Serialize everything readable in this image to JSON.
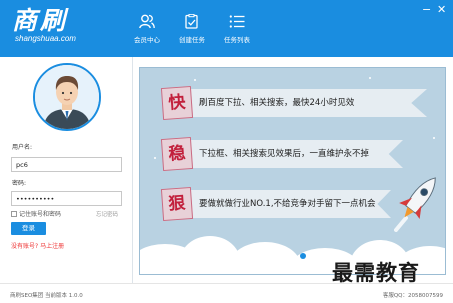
{
  "app": {
    "logo_text": "商刷",
    "logo_sub": "shangshuaa.com"
  },
  "nav": [
    {
      "label": "会员中心",
      "icon": "member-icon"
    },
    {
      "label": "创建任务",
      "icon": "create-task-icon"
    },
    {
      "label": "任务列表",
      "icon": "task-list-icon"
    }
  ],
  "window": {
    "minimize": "−",
    "close": "✕"
  },
  "login": {
    "username_label": "用户名:",
    "username_value": "pc6",
    "password_label": "密码:",
    "password_value": "••••••••••",
    "remember_label": "记住账号和密码",
    "forgot_label": "忘记密码",
    "login_button": "登录",
    "register_link": "没有账号? 马上注册"
  },
  "banner": {
    "items": [
      {
        "badge": "快",
        "text": "刷百度下拉、相关搜索，最快24小时见效"
      },
      {
        "badge": "稳",
        "text": "下拉框、相关搜索见效果后，一直维护永不掉"
      },
      {
        "badge": "狠",
        "text": "要做就做行业NO.1,不给竞争对手留下一点机会"
      }
    ]
  },
  "status": {
    "left": "商刷SEO集团 当前版本 1.0.0",
    "right": "客服QQ：2058007599"
  },
  "watermark": "最需教育",
  "colors": {
    "primary": "#1a8de0",
    "accent_red": "#c2203c",
    "banner_bg": "#b9d2e2"
  }
}
